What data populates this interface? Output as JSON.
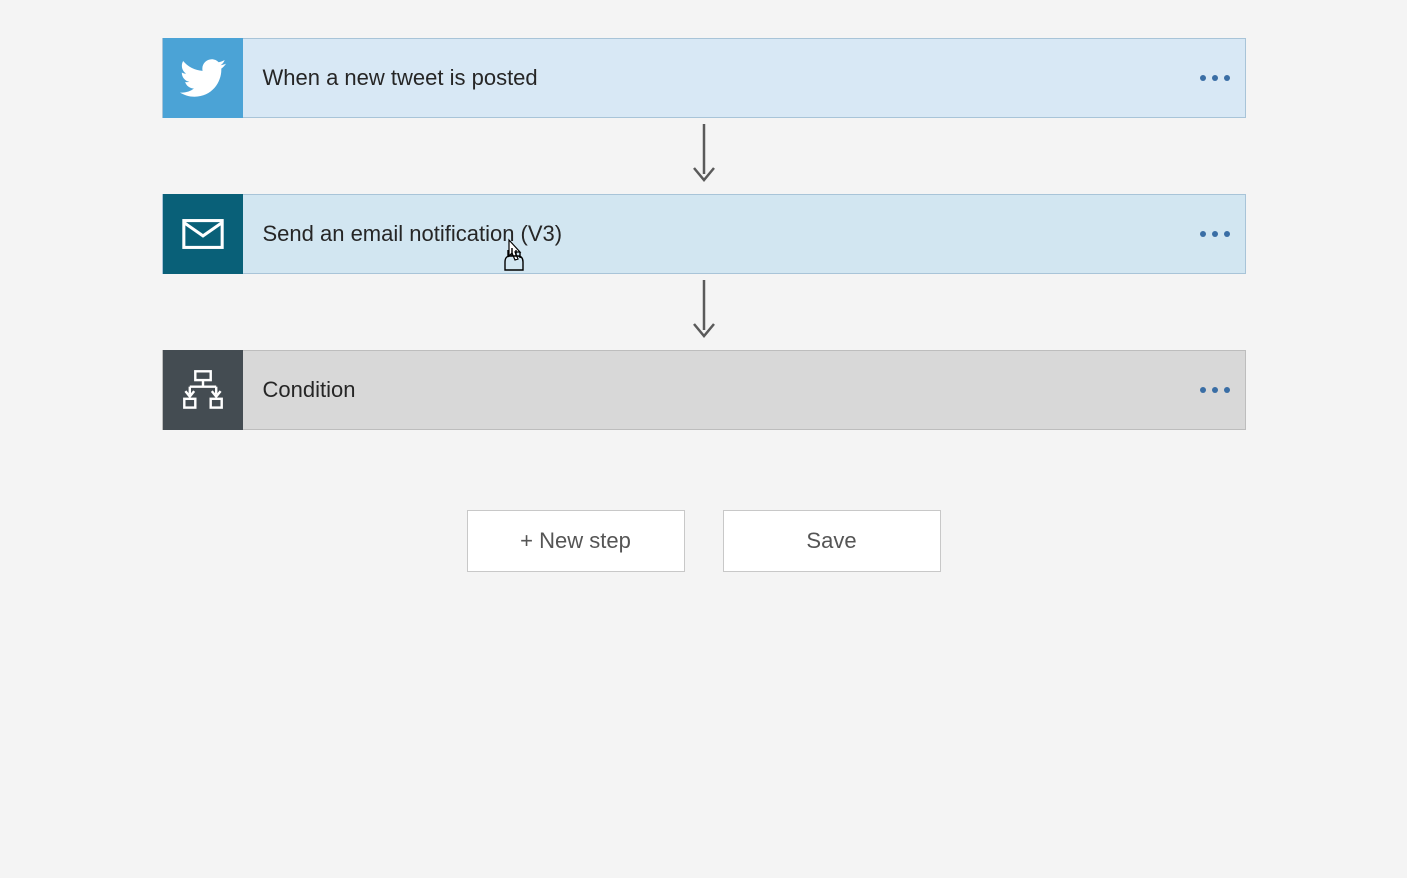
{
  "flow": {
    "steps": [
      {
        "id": "twitter-trigger",
        "title": "When a new tweet is posted",
        "iconType": "twitter"
      },
      {
        "id": "email-action",
        "title": "Send an email notification (V3)",
        "iconType": "email"
      },
      {
        "id": "condition-control",
        "title": "Condition",
        "iconType": "condition"
      }
    ]
  },
  "buttons": {
    "newStep": "+ New step",
    "save": "Save"
  }
}
